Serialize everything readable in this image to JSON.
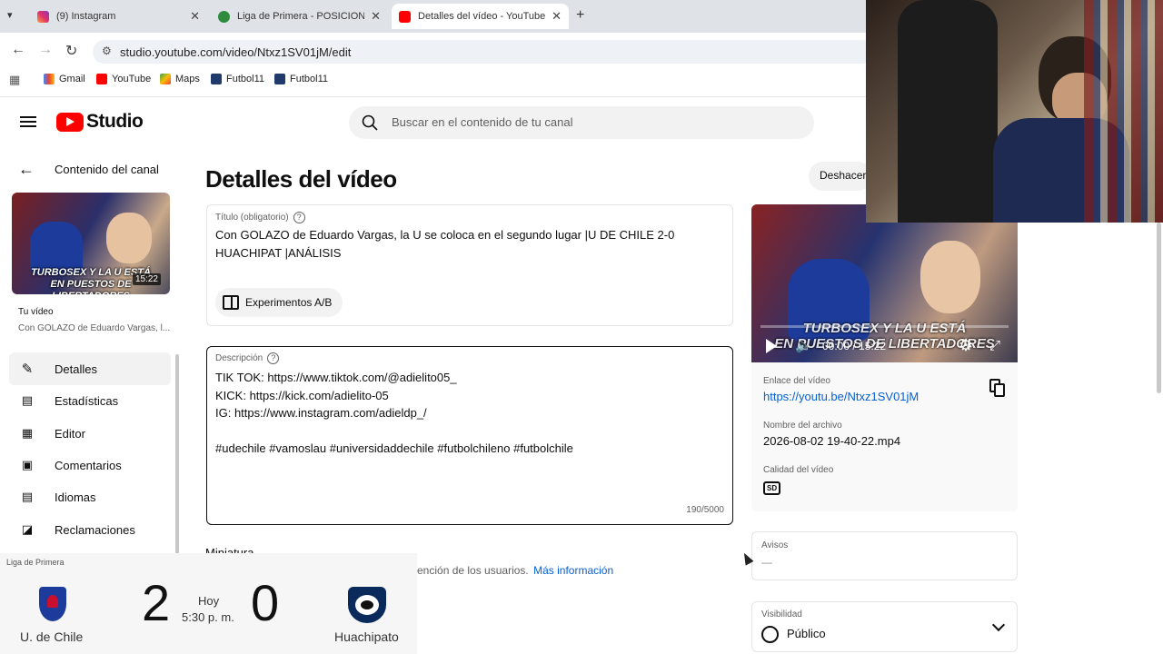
{
  "browser": {
    "tabs": [
      {
        "title": "(9) Instagram",
        "color": "#e1306c"
      },
      {
        "title": "Liga de Primera - POSICIONES,",
        "color": "#2e8b3d"
      },
      {
        "title": "Detalles del vídeo - YouTube St",
        "color": "#ff0000"
      }
    ],
    "url": "studio.youtube.com/video/Ntxz1SV01jM/edit",
    "bookmarks": [
      "Gmail",
      "YouTube",
      "Maps",
      "Futbol11",
      "Futbol11"
    ]
  },
  "header": {
    "logo_text": "Studio",
    "search_placeholder": "Buscar en el contenido de tu canal"
  },
  "sidebar": {
    "back_label": "Contenido del canal",
    "thumb_caption_line1": "TURBOSEX Y LA U ESTÁ",
    "thumb_caption_line2": "EN PUESTOS DE LIBERTADORES",
    "thumb_duration": "15:22",
    "your_video_label": "Tu vídeo",
    "your_video_title": "Con GOLAZO de Eduardo Vargas, l...",
    "items": [
      {
        "label": "Detalles",
        "icon": "pencil-icon"
      },
      {
        "label": "Estadísticas",
        "icon": "analytics-icon"
      },
      {
        "label": "Editor",
        "icon": "film-icon"
      },
      {
        "label": "Comentarios",
        "icon": "comment-icon"
      },
      {
        "label": "Idiomas",
        "icon": "subtitles-icon"
      },
      {
        "label": "Reclamaciones",
        "icon": "copyright-icon"
      }
    ]
  },
  "main": {
    "page_title": "Detalles del vídeo",
    "undo_label": "Deshacer",
    "title_field": {
      "label": "Título (obligatorio)",
      "value": "Con GOLAZO de Eduardo Vargas, la U se coloca en el segundo lugar |U DE CHILE 2-0 HUACHIPAT |ANÁLISIS"
    },
    "ab_button": "Experimentos A/B",
    "description": {
      "label": "Descripción",
      "lines": [
        "TIK TOK: https://www.tiktok.com/@adielito05_",
        "KICK: https://kick.com/adielito-05",
        "IG: https://www.instagram.com/adieldp_/",
        "",
        "#udechile #vamoslau #universidaddechile #futbolchileno #futbolchile"
      ],
      "counter": "190/5000"
    },
    "thumbnail_heading": "Miniatura",
    "thumbnail_help": "ención de los usuarios.",
    "more_info": "Más información"
  },
  "preview": {
    "caption_line1": "TURBOSEX Y LA U ESTÁ",
    "caption_line2": "EN PUESTOS DE LIBERTADORES",
    "time": "00:00 / 15:22",
    "link_label": "Enlace del vídeo",
    "link": "https://youtu.be/Ntxz1SV01jM",
    "filename_label": "Nombre del archivo",
    "filename": "2026-08-02 19-40-22.mp4",
    "quality_label": "Calidad del vídeo",
    "quality_badge": "SD",
    "notices_label": "Avisos",
    "notices_value": "—",
    "visibility_label": "Visibilidad",
    "visibility_value": "Público"
  },
  "scoreboard": {
    "league": "Liga de Primera",
    "home_team": "U. de Chile",
    "home_score": "2",
    "status_day": "Hoy",
    "status_time": "5:30 p. m.",
    "away_score": "0",
    "away_team": "Huachipato"
  }
}
